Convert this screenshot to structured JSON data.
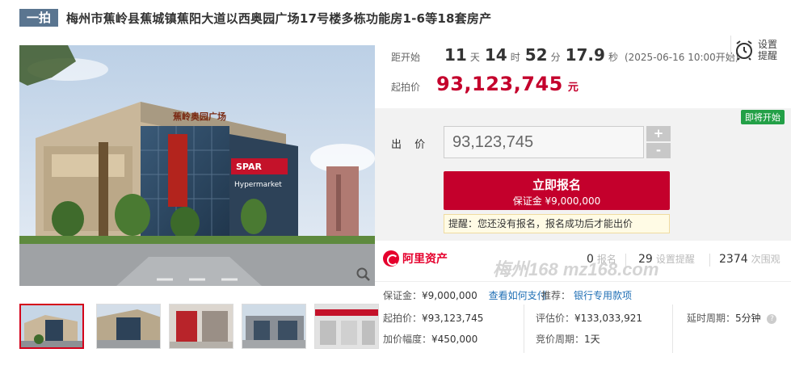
{
  "title": {
    "tag": "一拍",
    "text": "梅州市蕉岭县蕉城镇蕉阳大道以西奥园广场17号楼多栋功能房1-6等18套房产"
  },
  "countdown": {
    "label": "距开始",
    "days": "11",
    "days_unit": "天",
    "hours": "14",
    "hours_unit": "时",
    "minutes": "52",
    "minutes_unit": "分",
    "seconds": "17.9",
    "seconds_unit": "秒",
    "start_time": "(2025-06-16 10:00开始)"
  },
  "start_price": {
    "label": "起拍价",
    "value": "93,123,745",
    "unit": "元"
  },
  "reminder": {
    "label": "设置提醒",
    "icon": "alarm-clock-icon"
  },
  "status_badge": "即将开始",
  "bid": {
    "label": "出 价",
    "value": "93,123,745",
    "plus": "+",
    "minus": "-"
  },
  "signup_button": {
    "label": "立即报名",
    "deposit": "保证金 ¥9,000,000"
  },
  "notice": "提醒：您还没有报名，报名成功后才能出价",
  "platform": {
    "name": "阿里资产",
    "logo_icon": "ali-assets-logo-icon"
  },
  "stats": [
    {
      "value": "0",
      "label": "报名"
    },
    {
      "value": "29",
      "label": "设置提醒"
    },
    {
      "value": "2374",
      "label": "次围观"
    }
  ],
  "watermark": "梅州168 mz168.com",
  "info": {
    "deposit_label": "保证金：",
    "deposit_value": "¥9,000,000",
    "deposit_link": "查看如何支付",
    "recommend_label": "推荐：",
    "recommend_link": "银行专用款项",
    "start_price_label": "起拍价：",
    "start_price_value": "¥93,123,745",
    "assessed_label": "评估价：",
    "assessed_value": "¥133,033,921",
    "delay_label": "延时周期：",
    "delay_value": "5分钟",
    "increment_label": "加价幅度：",
    "increment_value": "¥450,000",
    "bid_cycle_label": "竞价周期：",
    "bid_cycle_value": "1天",
    "help_icon": "?"
  },
  "mall_sign": {
    "top": "蕉岭奥园广场",
    "spar": "SPAR",
    "hyper": "Hypermarket"
  },
  "colors": {
    "accent_red": "#c4002c",
    "tag_blue": "#5a7590",
    "badge_green": "#23a047",
    "link_blue": "#1f6fb5"
  }
}
